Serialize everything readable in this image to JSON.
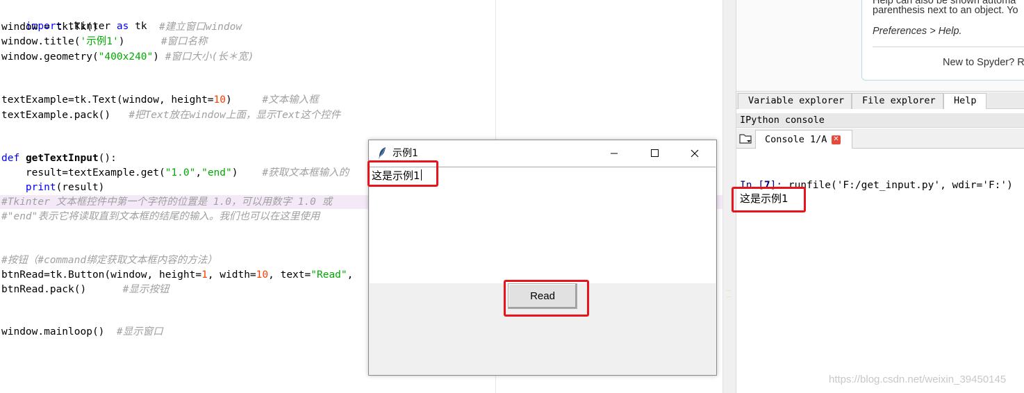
{
  "editor": {
    "lines": [
      [
        "import tkinter as tk"
      ],
      [
        "window = tk.Tk()",
        "#建立窗口window"
      ],
      [
        "window.title('示例1')",
        "#窗口名称"
      ],
      [
        "window.geometry(\"400x240\")",
        "#窗口大小(长＊宽)"
      ],
      [
        "textExample=tk.Text(window, height=10)",
        "#文本输入框"
      ],
      [
        "textExample.pack()",
        "#把Text放在window上面，显示Text这个控件"
      ],
      [
        "def getTextInput():"
      ],
      [
        "    result=textExample.get(\"1.0\",\"end\")",
        "#获取文本框输入的"
      ],
      [
        "    print(result)"
      ],
      [
        "#Tkinter 文本框控件中第一个字符的位置是 1.0，可以用数字 1.0 或"
      ],
      [
        "#\"end\"表示它将读取直到文本框的结尾的输入。我们也可以在这里使用"
      ],
      [
        "#按钮（#command绑定获取文本框内容的方法）"
      ],
      [
        "btnRead=tk.Button(window, height=1, width=10, text=\"Read\","
      ],
      [
        "btnRead.pack()",
        "#显示按钮"
      ],
      [
        "window.mainloop()",
        "#显示窗口"
      ]
    ]
  },
  "help": {
    "line1": "Help can also be shown automa",
    "line2": "parenthesis next to an object. Yo",
    "line3": "Preferences > Help.",
    "line4": "New to Spyder? R"
  },
  "tabs": {
    "variable_explorer": "Variable explorer",
    "file_explorer": "File explorer",
    "help": "Help"
  },
  "console": {
    "pane_title": "IPython console",
    "tab_label": "Console 1/A",
    "close_glyph": "✕",
    "prompt_in": "In [",
    "prompt_num": "7",
    "prompt_close": "]: ",
    "command": "runfile('F:/get_input.py', wdir='F:')",
    "output": "这是示例1"
  },
  "tk_window": {
    "title": "示例1",
    "text_value": "这是示例1",
    "button_label": "Read"
  },
  "watermark": "https://blog.csdn.net/weixin_39450145",
  "colors": {
    "annotation": "#e8141c",
    "keyword": "#0000ff",
    "string": "#00aa00",
    "number": "#ff3c00",
    "comment": "#a0a0a0"
  }
}
